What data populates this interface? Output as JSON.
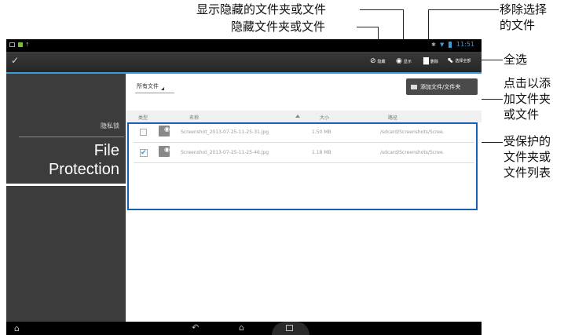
{
  "callouts": {
    "show_hidden": "显示隐藏的文件夹或文件",
    "hide": "隐藏文件夹或文件",
    "remove_selected": [
      "移除选择",
      "的文件"
    ],
    "select_all": "全选",
    "add": [
      "点击以添",
      "加文件夹",
      "或文件"
    ],
    "protected_list": [
      "受保护的",
      "文件夹或",
      "文件列表"
    ]
  },
  "status": {
    "time": "11:51"
  },
  "actionbar": {
    "hide_label": "隐藏",
    "show_label": "显示",
    "delete_label": "删除",
    "select_all_label": "选择全部"
  },
  "sidebar": {
    "category": "隐私锁",
    "title_line1": "File",
    "title_line2": "Protection"
  },
  "content": {
    "filter": "所有文件",
    "add_button": "添加文件/文件夹",
    "columns": {
      "type": "类型",
      "name": "名称",
      "size": "大小",
      "path": "路径"
    },
    "rows": [
      {
        "name": "Screenshot_2013-07-25-11-25-31.jpg",
        "size": "1.50 MB",
        "path": "/sdcard/Screenshots/Scree.",
        "checked": false
      },
      {
        "name": "Screenshot_2013-07-25-11-25-46.jpg",
        "size": "1.18 MB",
        "path": "/sdcard/Screenshots/Scree.",
        "checked": true
      }
    ]
  },
  "colors": {
    "accent": "#3d9bd6",
    "sidebar": "#3c3c3c",
    "callout_dot": "#1a5fb4"
  }
}
